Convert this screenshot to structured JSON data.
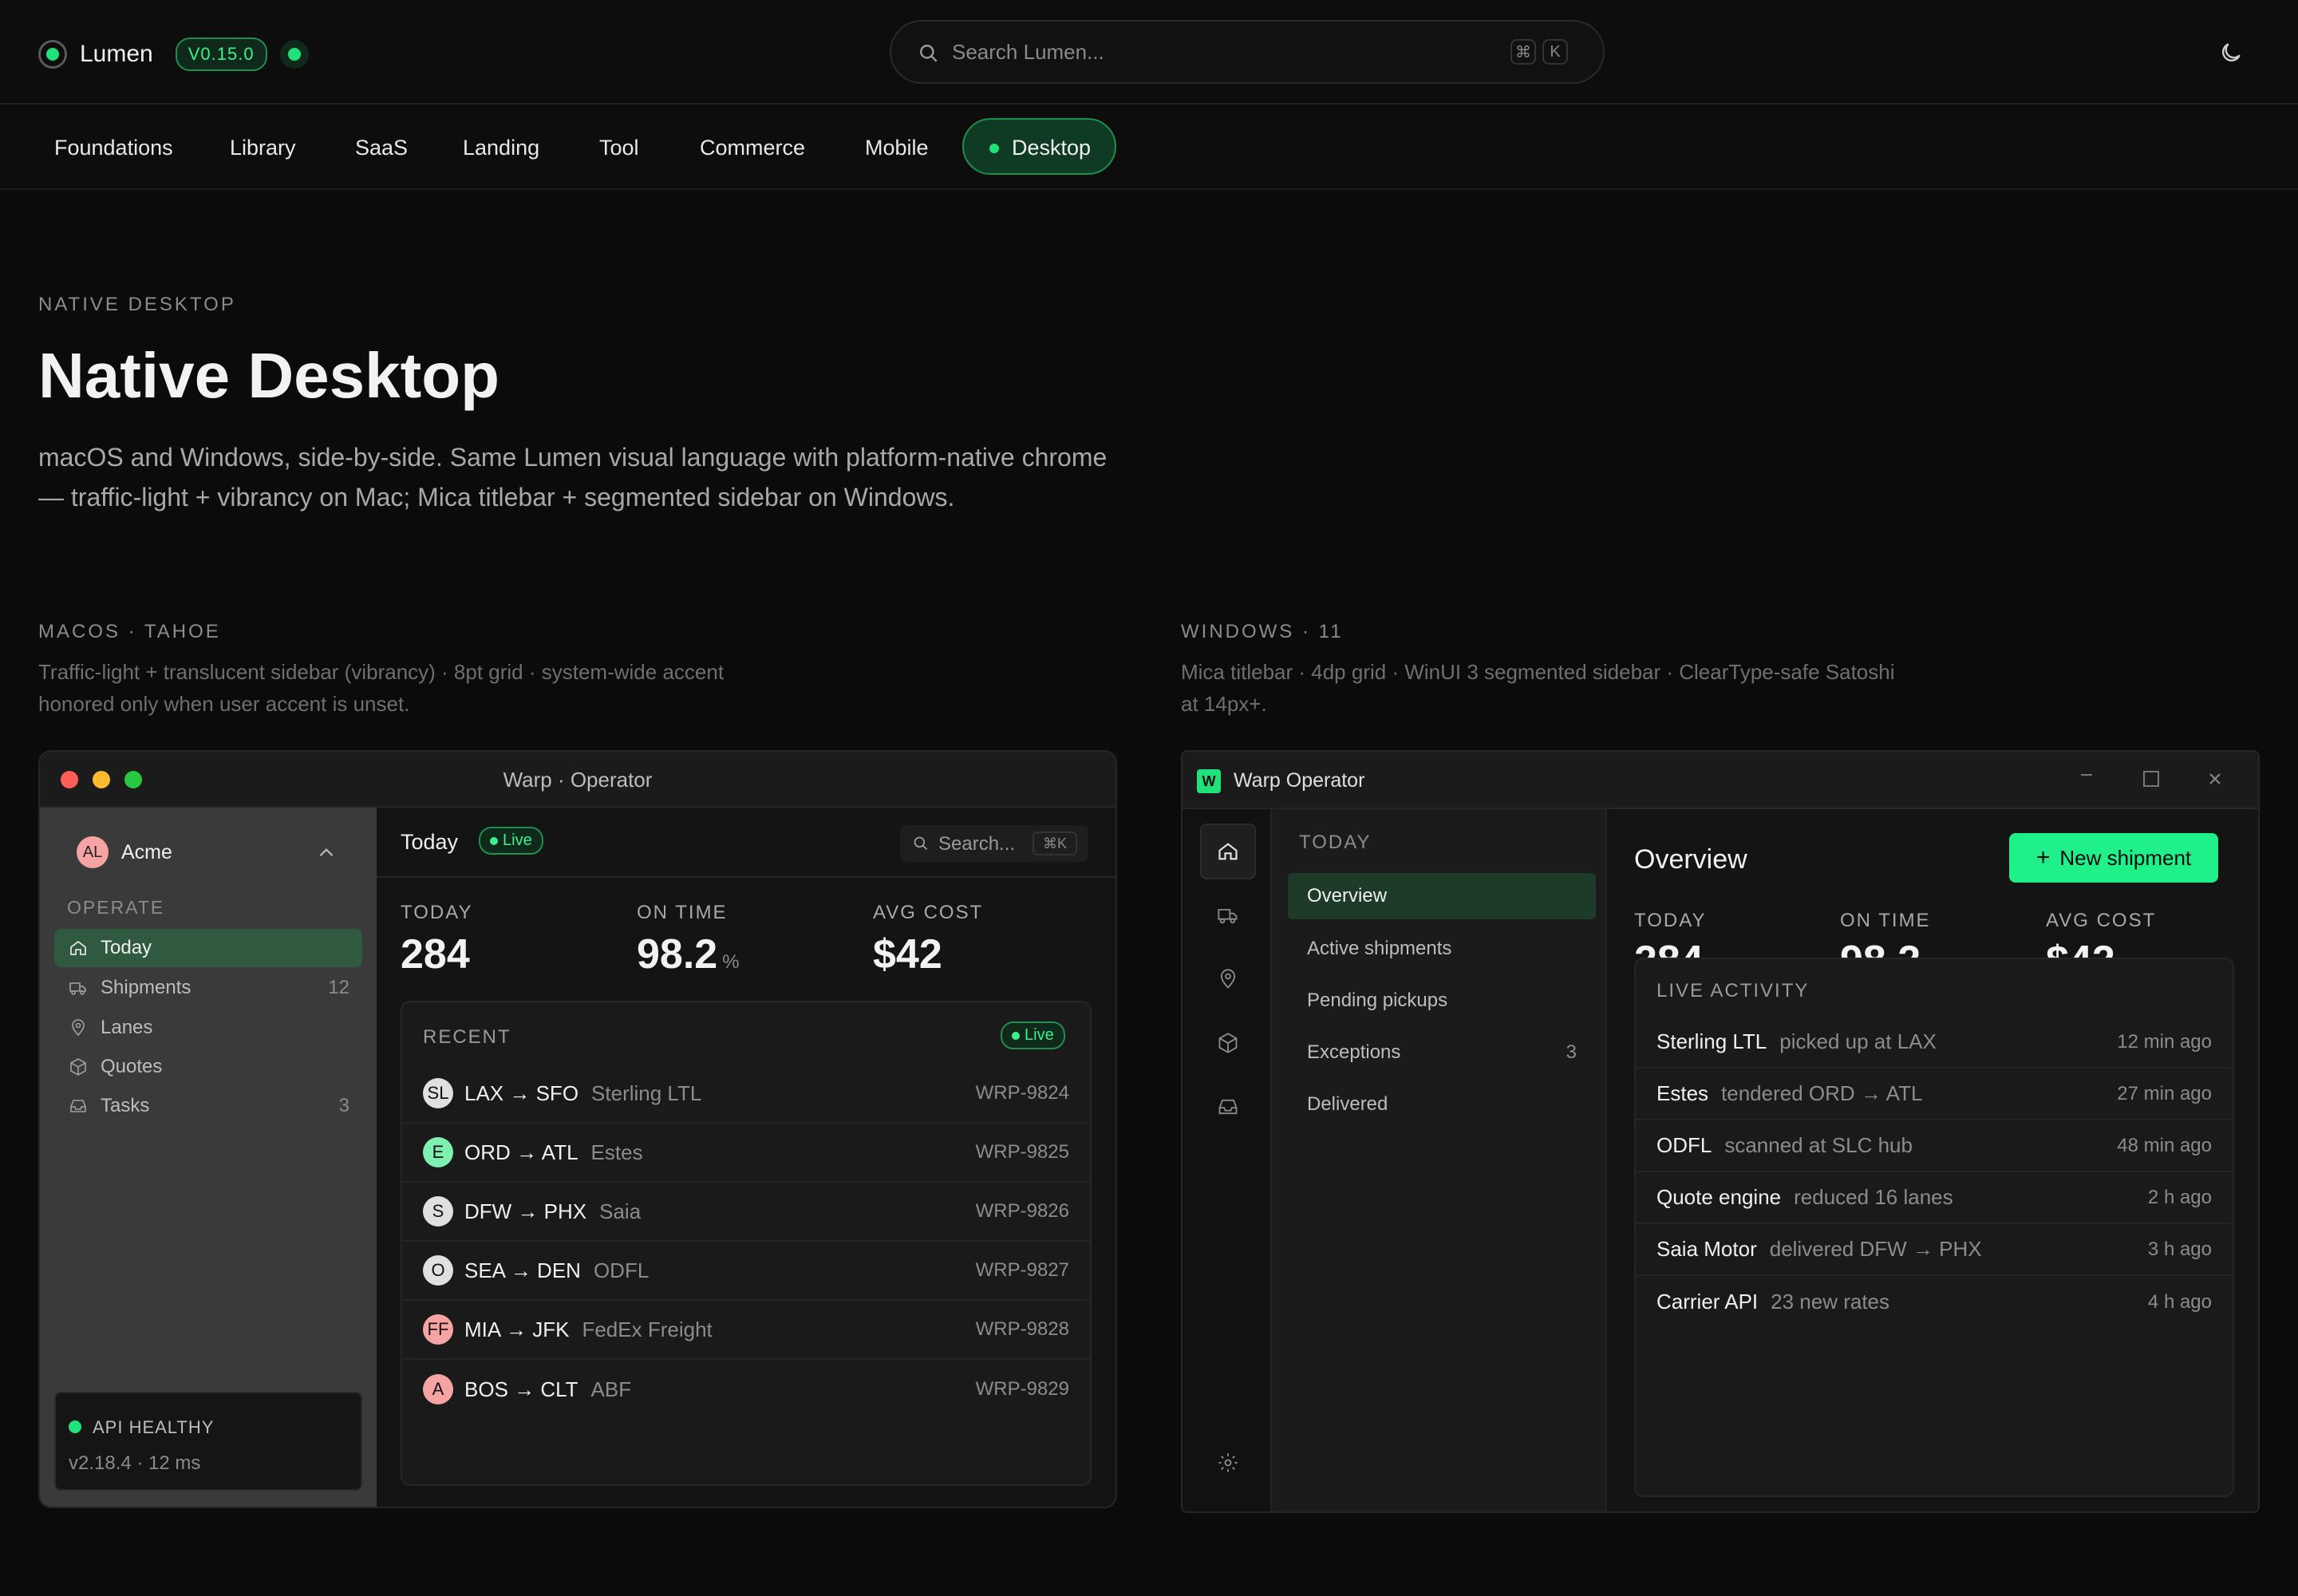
{
  "app": {
    "name": "Lumen",
    "version": "V0.15.0"
  },
  "search": {
    "placeholder": "Search Lumen...",
    "kbd1": "⌘",
    "kbd2": "K"
  },
  "nav": {
    "items": [
      "Foundations",
      "Library",
      "SaaS",
      "Landing",
      "Tool",
      "Commerce",
      "Mobile"
    ],
    "active": "Desktop"
  },
  "hero": {
    "eyebrow": "NATIVE DESKTOP",
    "title": "Native Desktop",
    "desc": "macOS and Windows, side-by-side. Same Lumen visual language with platform-native chrome — traffic-light + vibrancy on Mac; Mica titlebar + segmented sidebar on Windows."
  },
  "mac_section": {
    "label": "MACOS · TAHOE",
    "desc": "Traffic-light + translucent sidebar (vibrancy) · 8pt grid · system-wide accent honored only when user accent is unset."
  },
  "win_section": {
    "label": "WINDOWS · 11",
    "desc": "Mica titlebar · 4dp grid · WinUI 3 segmented sidebar · ClearType-safe Satoshi at 14px+."
  },
  "mac": {
    "title": "Warp · Operator",
    "workspace": {
      "initials": "AL",
      "name": "Acme"
    },
    "section": "OPERATE",
    "items": [
      {
        "label": "Today",
        "count": ""
      },
      {
        "label": "Shipments",
        "count": "12"
      },
      {
        "label": "Lanes",
        "count": ""
      },
      {
        "label": "Quotes",
        "count": ""
      },
      {
        "label": "Tasks",
        "count": "3"
      }
    ],
    "health": {
      "label": "API HEALTHY",
      "meta": "v2.18.4 · 12 ms"
    },
    "header": {
      "title": "Today",
      "live": "Live",
      "search": "Search...",
      "kbd": "⌘K"
    },
    "stats": [
      {
        "label": "TODAY",
        "value": "284",
        "unit": ""
      },
      {
        "label": "ON TIME",
        "value": "98.2",
        "unit": "%"
      },
      {
        "label": "AVG COST",
        "value": "$42",
        "unit": ""
      }
    ],
    "recent": {
      "label": "RECENT",
      "live": "Live",
      "rows": [
        {
          "initials": "SL",
          "route": "LAX → SFO",
          "carrier": "Sterling LTL",
          "ref": "WRP-9824",
          "color": "#e0e0e0"
        },
        {
          "initials": "E",
          "route": "ORD → ATL",
          "carrier": "Estes",
          "ref": "WRP-9825",
          "color": "#7ef0b0"
        },
        {
          "initials": "S",
          "route": "DFW → PHX",
          "carrier": "Saia",
          "ref": "WRP-9826",
          "color": "#e0e0e0"
        },
        {
          "initials": "O",
          "route": "SEA → DEN",
          "carrier": "ODFL",
          "ref": "WRP-9827",
          "color": "#e0e0e0"
        },
        {
          "initials": "FF",
          "route": "MIA → JFK",
          "carrier": "FedEx Freight",
          "ref": "WRP-9828",
          "color": "#f5a3a3"
        },
        {
          "initials": "A",
          "route": "BOS → CLT",
          "carrier": "ABF",
          "ref": "WRP-9829",
          "color": "#f5a3a3"
        }
      ]
    }
  },
  "win": {
    "title": "Warp Operator",
    "logo": "W",
    "section": "TODAY",
    "items": [
      {
        "label": "Overview",
        "count": ""
      },
      {
        "label": "Active shipments",
        "count": ""
      },
      {
        "label": "Pending pickups",
        "count": ""
      },
      {
        "label": "Exceptions",
        "count": "3"
      },
      {
        "label": "Delivered",
        "count": ""
      }
    ],
    "main_title": "Overview",
    "new_button": "New shipment",
    "stats": [
      {
        "label": "TODAY",
        "value": "284",
        "unit": ""
      },
      {
        "label": "ON TIME",
        "value": "98.2",
        "unit": "%"
      },
      {
        "label": "AVG COST",
        "value": "$42",
        "unit": ""
      }
    ],
    "activity": {
      "label": "LIVE ACTIVITY",
      "rows": [
        {
          "who": "Sterling LTL",
          "what": "picked up at LAX",
          "when": "12 min ago"
        },
        {
          "who": "Estes",
          "what": "tendered ORD → ATL",
          "when": "27 min ago"
        },
        {
          "who": "ODFL",
          "what": "scanned at SLC hub",
          "when": "48 min ago"
        },
        {
          "who": "Quote engine",
          "what": "reduced 16 lanes",
          "when": "2 h ago"
        },
        {
          "who": "Saia Motor",
          "what": "delivered DFW → PHX",
          "when": "3 h ago"
        },
        {
          "who": "Carrier API",
          "what": "23 new rates",
          "when": "4 h ago"
        }
      ]
    }
  },
  "colors": {
    "accent": "#20e27a",
    "bg": "#0b0b0b"
  }
}
